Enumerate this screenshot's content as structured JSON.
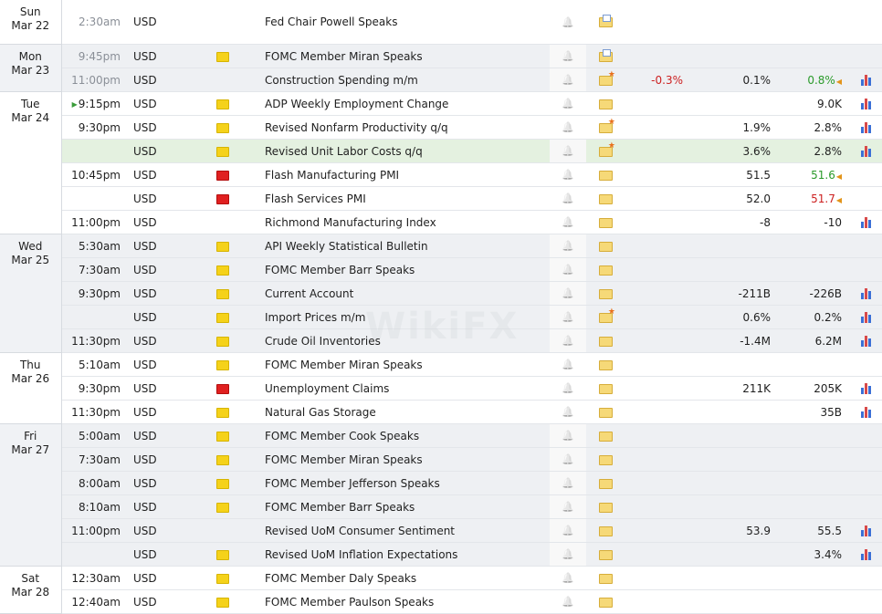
{
  "colors": {
    "date_column_bg": "#f0f2f5",
    "row_grey": "#eef0f3",
    "row_highlight": "#e4f1e0",
    "negative": "#cc1f1f",
    "positive": "#2a9a2a",
    "importance_low": "#f5d21a",
    "importance_medium": "#f08b2e",
    "importance_high": "#e02020"
  },
  "watermark": "WikiFX",
  "calendar": {
    "rows": [
      {
        "day": "Sun",
        "date": "Mar 22",
        "span": 1,
        "time": "2:30am",
        "time_muted": true,
        "currency": "USD",
        "importance": "medium",
        "event": "Fed Chair Powell Speaks",
        "folder": "doc",
        "actual": "",
        "forecast": "",
        "previous": "",
        "actual_class": "",
        "previous_class": "",
        "chart": false,
        "shade": "white"
      },
      {
        "day": "Mon",
        "date": "Mar 23",
        "span": 2,
        "time": "9:45pm",
        "time_muted": true,
        "currency": "USD",
        "importance": "low",
        "event": "FOMC Member Miran Speaks",
        "folder": "doc",
        "actual": "",
        "forecast": "",
        "previous": "",
        "actual_class": "",
        "previous_class": "",
        "chart": false,
        "shade": "grey"
      },
      {
        "time": "11:00pm",
        "time_muted": true,
        "currency": "USD",
        "importance": "medium",
        "event": "Construction Spending m/m",
        "folder": "star",
        "actual": "-0.3%",
        "forecast": "0.1%",
        "previous": "0.8%",
        "actual_class": "neg",
        "previous_class": "pos",
        "chart": true,
        "shade": "grey"
      },
      {
        "day": "Tue",
        "date": "Mar 24",
        "span": 6,
        "time": "9:15pm",
        "time_muted": false,
        "playing": true,
        "currency": "USD",
        "importance": "low",
        "event": "ADP Weekly Employment Change",
        "folder": "plain",
        "actual": "",
        "forecast": "",
        "previous": "9.0K",
        "actual_class": "",
        "previous_class": "",
        "chart": true,
        "shade": "white"
      },
      {
        "time": "9:30pm",
        "time_muted": false,
        "currency": "USD",
        "importance": "low",
        "event": "Revised Nonfarm Productivity q/q",
        "folder": "star",
        "actual": "",
        "forecast": "1.9%",
        "previous": "2.8%",
        "actual_class": "",
        "previous_class": "",
        "chart": true,
        "shade": "white"
      },
      {
        "time": "",
        "time_muted": false,
        "currency": "USD",
        "importance": "low",
        "event": "Revised Unit Labor Costs q/q",
        "folder": "star",
        "actual": "",
        "forecast": "3.6%",
        "previous": "2.8%",
        "actual_class": "",
        "previous_class": "",
        "chart": true,
        "shade": "highlight"
      },
      {
        "time": "10:45pm",
        "time_muted": false,
        "currency": "USD",
        "importance": "high",
        "event": "Flash Manufacturing PMI",
        "folder": "plain",
        "actual": "",
        "forecast": "51.5",
        "previous": "51.6",
        "actual_class": "",
        "previous_class": "pos",
        "chart": false,
        "shade": "white"
      },
      {
        "time": "",
        "time_muted": false,
        "currency": "USD",
        "importance": "high",
        "event": "Flash Services PMI",
        "folder": "plain",
        "actual": "",
        "forecast": "52.0",
        "previous": "51.7",
        "actual_class": "",
        "previous_class": "neg",
        "chart": false,
        "shade": "white"
      },
      {
        "time": "11:00pm",
        "time_muted": false,
        "currency": "USD",
        "importance": "medium",
        "event": "Richmond Manufacturing Index",
        "folder": "plain",
        "actual": "",
        "forecast": "-8",
        "previous": "-10",
        "actual_class": "",
        "previous_class": "",
        "chart": true,
        "shade": "white"
      },
      {
        "day": "Wed",
        "date": "Mar 25",
        "span": 5,
        "time": "5:30am",
        "time_muted": false,
        "currency": "USD",
        "importance": "low",
        "event": "API Weekly Statistical Bulletin",
        "folder": "plain",
        "actual": "",
        "forecast": "",
        "previous": "",
        "actual_class": "",
        "previous_class": "",
        "chart": false,
        "shade": "grey"
      },
      {
        "time": "7:30am",
        "time_muted": false,
        "currency": "USD",
        "importance": "low",
        "event": "FOMC Member Barr Speaks",
        "folder": "plain",
        "actual": "",
        "forecast": "",
        "previous": "",
        "actual_class": "",
        "previous_class": "",
        "chart": false,
        "shade": "grey"
      },
      {
        "time": "9:30pm",
        "time_muted": false,
        "currency": "USD",
        "importance": "low",
        "event": "Current Account",
        "folder": "plain",
        "actual": "",
        "forecast": "-211B",
        "previous": "-226B",
        "actual_class": "",
        "previous_class": "",
        "chart": true,
        "shade": "grey"
      },
      {
        "time": "",
        "time_muted": false,
        "currency": "USD",
        "importance": "low",
        "event": "Import Prices m/m",
        "folder": "star",
        "actual": "",
        "forecast": "0.6%",
        "previous": "0.2%",
        "actual_class": "",
        "previous_class": "",
        "chart": true,
        "shade": "grey"
      },
      {
        "time": "11:30pm",
        "time_muted": false,
        "currency": "USD",
        "importance": "low",
        "event": "Crude Oil Inventories",
        "folder": "plain",
        "actual": "",
        "forecast": "-1.4M",
        "previous": "6.2M",
        "actual_class": "",
        "previous_class": "",
        "chart": true,
        "shade": "grey"
      },
      {
        "day": "Thu",
        "date": "Mar 26",
        "span": 3,
        "time": "5:10am",
        "time_muted": false,
        "currency": "USD",
        "importance": "low",
        "event": "FOMC Member Miran Speaks",
        "folder": "plain",
        "actual": "",
        "forecast": "",
        "previous": "",
        "actual_class": "",
        "previous_class": "",
        "chart": false,
        "shade": "white"
      },
      {
        "time": "9:30pm",
        "time_muted": false,
        "currency": "USD",
        "importance": "high",
        "event": "Unemployment Claims",
        "folder": "plain",
        "actual": "",
        "forecast": "211K",
        "previous": "205K",
        "actual_class": "",
        "previous_class": "",
        "chart": true,
        "shade": "white"
      },
      {
        "time": "11:30pm",
        "time_muted": false,
        "currency": "USD",
        "importance": "low",
        "event": "Natural Gas Storage",
        "folder": "plain",
        "actual": "",
        "forecast": "",
        "previous": "35B",
        "actual_class": "",
        "previous_class": "",
        "chart": true,
        "shade": "white"
      },
      {
        "day": "Fri",
        "date": "Mar 27",
        "span": 6,
        "time": "5:00am",
        "time_muted": false,
        "currency": "USD",
        "importance": "low",
        "event": "FOMC Member Cook Speaks",
        "folder": "plain",
        "actual": "",
        "forecast": "",
        "previous": "",
        "actual_class": "",
        "previous_class": "",
        "chart": false,
        "shade": "grey"
      },
      {
        "time": "7:30am",
        "time_muted": false,
        "currency": "USD",
        "importance": "low",
        "event": "FOMC Member Miran Speaks",
        "folder": "plain",
        "actual": "",
        "forecast": "",
        "previous": "",
        "actual_class": "",
        "previous_class": "",
        "chart": false,
        "shade": "grey"
      },
      {
        "time": "8:00am",
        "time_muted": false,
        "currency": "USD",
        "importance": "low",
        "event": "FOMC Member Jefferson Speaks",
        "folder": "plain",
        "actual": "",
        "forecast": "",
        "previous": "",
        "actual_class": "",
        "previous_class": "",
        "chart": false,
        "shade": "grey"
      },
      {
        "time": "8:10am",
        "time_muted": false,
        "currency": "USD",
        "importance": "low",
        "event": "FOMC Member Barr Speaks",
        "folder": "plain",
        "actual": "",
        "forecast": "",
        "previous": "",
        "actual_class": "",
        "previous_class": "",
        "chart": false,
        "shade": "grey"
      },
      {
        "time": "11:00pm",
        "time_muted": false,
        "currency": "USD",
        "importance": "medium",
        "event": "Revised UoM Consumer Sentiment",
        "folder": "plain",
        "actual": "",
        "forecast": "53.9",
        "previous": "55.5",
        "actual_class": "",
        "previous_class": "",
        "chart": true,
        "shade": "grey"
      },
      {
        "time": "",
        "time_muted": false,
        "currency": "USD",
        "importance": "low",
        "event": "Revised UoM Inflation Expectations",
        "folder": "plain",
        "actual": "",
        "forecast": "",
        "previous": "3.4%",
        "actual_class": "",
        "previous_class": "",
        "chart": true,
        "shade": "grey"
      },
      {
        "day": "Sat",
        "date": "Mar 28",
        "span": 2,
        "time": "12:30am",
        "time_muted": false,
        "currency": "USD",
        "importance": "low",
        "event": "FOMC Member Daly Speaks",
        "folder": "plain",
        "actual": "",
        "forecast": "",
        "previous": "",
        "actual_class": "",
        "previous_class": "",
        "chart": false,
        "shade": "white"
      },
      {
        "time": "12:40am",
        "time_muted": false,
        "currency": "USD",
        "importance": "low",
        "event": "FOMC Member Paulson Speaks",
        "folder": "plain",
        "actual": "",
        "forecast": "",
        "previous": "",
        "actual_class": "",
        "previous_class": "",
        "chart": false,
        "shade": "white"
      }
    ]
  }
}
